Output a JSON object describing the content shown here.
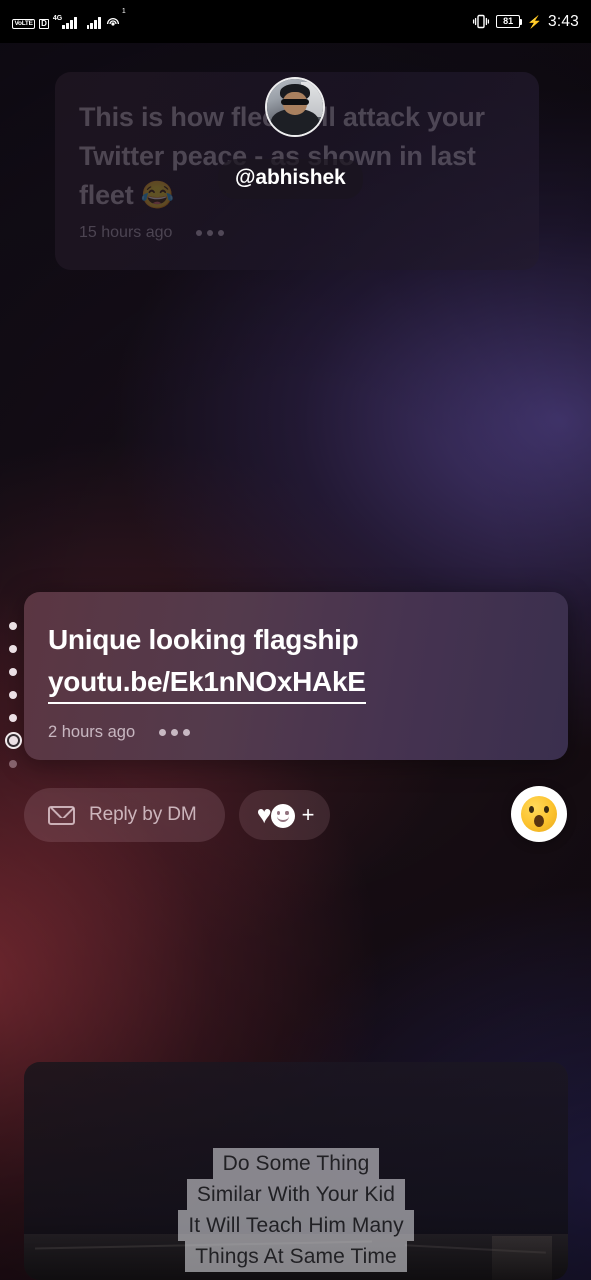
{
  "status_bar": {
    "volte_label": "VoLTE",
    "sim_label": "D",
    "network_type": "4G",
    "network_sub": "1",
    "wifi_superscript": "1",
    "vibrate_icon": "vibrate-icon",
    "battery_percent": "81",
    "charging_icon": "bolt-icon",
    "time": "3:43"
  },
  "previous_fleet": {
    "text": "This is how fleet will attack your Twitter peace - as shown in last fleet 😂",
    "timestamp": "15 hours ago",
    "menu_icon": "more-options-icon"
  },
  "author": {
    "handle": "@abhishek",
    "avatar_icon": "avatar"
  },
  "active_fleet": {
    "title": "Unique looking flagship",
    "link": "youtu.be/Ek1nNOxHAkE",
    "timestamp": "2 hours ago",
    "menu_icon": "more-options-icon"
  },
  "progress": {
    "total": 7,
    "current_index": 6,
    "dots": [
      "seen",
      "seen",
      "seen",
      "seen",
      "seen",
      "current",
      "unseen"
    ]
  },
  "actions": {
    "reply_label": "Reply by DM",
    "reply_icon": "envelope-icon",
    "react_heart_icon": "heart-icon",
    "react_smiley_icon": "smiley-icon",
    "react_plus_icon": "plus-icon",
    "quick_emoji": "😲",
    "quick_emoji_name": "astonished-face-emoji"
  },
  "next_fleet": {
    "caption_lines": [
      "Do Some Thing",
      "Similar With Your Kid",
      "It Will Teach Him Many",
      "Things At Same Time"
    ]
  },
  "colors": {
    "card_accent_left": "#5b3642",
    "card_accent_right": "#3a2f4e",
    "link_underline": "#ffffff",
    "emoji_button_bg": "#ffffff"
  }
}
